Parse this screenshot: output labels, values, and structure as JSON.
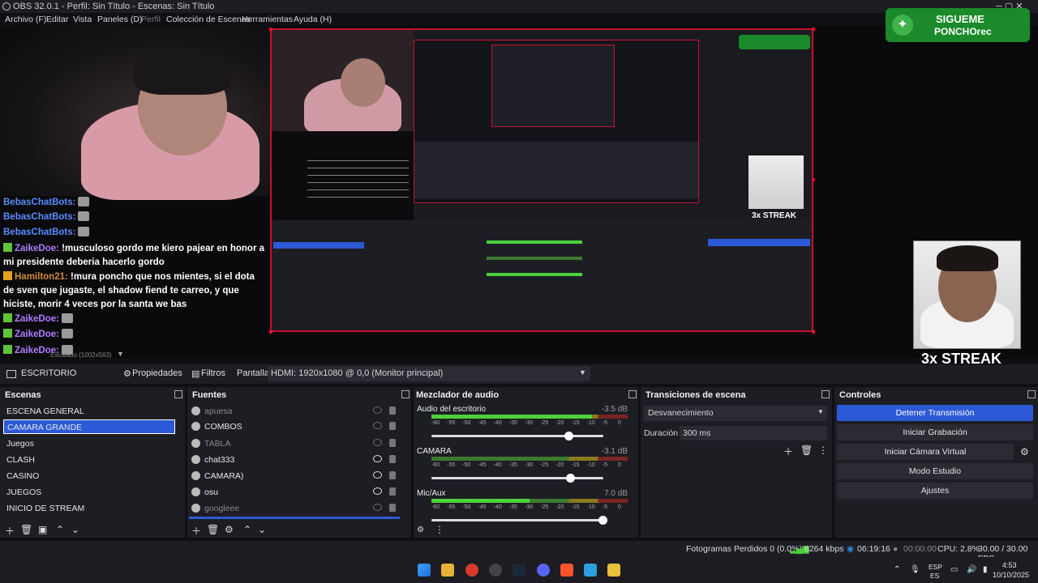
{
  "window": {
    "title": "OBS 32.0.1 - Perfil: Sin Título - Escenas: Sin Título"
  },
  "menu": [
    "Archivo (F)",
    "Editar",
    "Vista",
    "Paneles (D)",
    "Perfil",
    "Colección de Escenas",
    "Herramientas",
    "Ayuda (H)"
  ],
  "overlay": {
    "twitter_line1": "SIGUEME",
    "twitter_line2": "PONCHOrec",
    "streak_small": "3x STREAK",
    "streak_large": "3x STREAK"
  },
  "chat": [
    {
      "user": "BebasChatBots:",
      "msg": "",
      "color": "blue"
    },
    {
      "user": "BebasChatBots:",
      "msg": "",
      "color": "blue"
    },
    {
      "user": "BebasChatBots:",
      "msg": "",
      "color": "blue"
    },
    {
      "user": "ZaikeDoe:",
      "msg": "!musculoso gordo me kiero pajear en honor a mi presidente deberia hacerlo gordo",
      "color": "purple"
    },
    {
      "user": "Hamilton21:",
      "msg": "!mura poncho que nos mientes, si el dota de sven que jugaste, el shadow fiend te carreo, y que hiciste, morir 4 veces por la santa we bas",
      "color": "orange"
    },
    {
      "user": "ZaikeDoe:",
      "msg": "",
      "color": "purple"
    },
    {
      "user": "ZaikeDoe:",
      "msg": "",
      "color": "purple"
    },
    {
      "user": "ZaikeDoe:",
      "msg": "",
      "color": "purple"
    }
  ],
  "preview": {
    "zoom_label": "Escalado (1002x563)"
  },
  "source_bar": {
    "source_name": "ESCRITORIO",
    "properties": "Propiedades",
    "filters": "Filtros",
    "display_label": "Pantalla",
    "monitor": "HDMI: 1920x1080 @ 0,0 (Monitor principal)"
  },
  "scenes": {
    "title": "Escenas",
    "items": [
      "ESCENA GENERAL",
      "CAMARA GRANDE",
      "Juegos",
      "CLASH",
      "CASINO",
      "JUEGOS",
      "INICIO DE STREAM"
    ],
    "selected": "CAMARA GRANDE"
  },
  "sources": {
    "title": "Fuentes",
    "items": [
      {
        "name": "apuesa",
        "visible": false
      },
      {
        "name": "COMBOS",
        "visible": true
      },
      {
        "name": "TABLA",
        "visible": false
      },
      {
        "name": "chat333",
        "visible": true
      },
      {
        "name": "CAMARA)",
        "visible": true
      },
      {
        "name": "osu",
        "visible": true
      },
      {
        "name": "googleee",
        "visible": false
      }
    ]
  },
  "mixer": {
    "title": "Mezclador de audio",
    "channels": [
      {
        "name": "Audio del escritorio",
        "db": "-3.5 dB",
        "level": 0.82,
        "fader": 0.8
      },
      {
        "name": "CAMARA",
        "db": "-3.1 dB",
        "level": 0.0,
        "fader": 0.81
      },
      {
        "name": "Mic/Aux",
        "db": "7.0 dB",
        "level": 0.5,
        "fader": 1.0
      }
    ],
    "ticks": [
      "-60",
      "-55",
      "-50",
      "-45",
      "-40",
      "-35",
      "-30",
      "-25",
      "-20",
      "-15",
      "-10",
      "-5",
      "0"
    ]
  },
  "transitions": {
    "title": "Transiciones de escena",
    "selected": "Desvanecimiento",
    "duration_label": "Duración",
    "duration_value": "300 ms"
  },
  "controls": {
    "title": "Controles",
    "buttons": [
      "Detener Transmisión",
      "Iniciar Grabación",
      "Iniciar Cámara Virtual",
      "Modo Estudio",
      "Ajustes"
    ]
  },
  "status": {
    "dropped": "Fotogramas Perdidos 0 (0.0%)",
    "bitrate": "8264 kbps",
    "stream_time": "06:19:16",
    "rec_time": "00:00:00",
    "cpu": "CPU: 2.8%",
    "fps": "30.00 / 30.00 FPS"
  },
  "taskbar": {
    "lang1": "ESP",
    "lang2": "ES",
    "time": "4:53",
    "date": "10/10/2025"
  },
  "colors": {
    "accent": "#2c5ad6",
    "record_border": "#c8102e",
    "twitter_green": "#1a8a2a"
  }
}
